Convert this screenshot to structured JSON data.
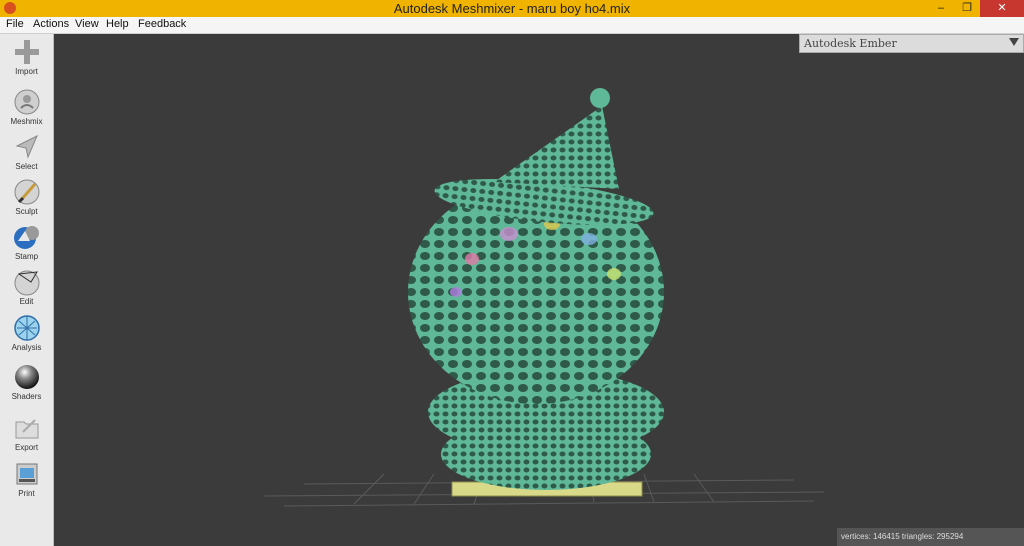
{
  "window": {
    "title": "Autodesk Meshmixer - maru boy ho4.mix",
    "minimize": "–",
    "maximize": "❐",
    "close": "✕"
  },
  "menu": [
    "File",
    "Actions",
    "View",
    "Help",
    "Feedback"
  ],
  "tools": [
    {
      "label": "Import",
      "icon": "plus-icon"
    },
    {
      "label": "Meshmix",
      "icon": "meshmix-icon"
    },
    {
      "label": "Select",
      "icon": "select-arrow-icon"
    },
    {
      "label": "Sculpt",
      "icon": "sculpt-brush-icon"
    },
    {
      "label": "Stamp",
      "icon": "stamp-icon"
    },
    {
      "label": "Edit",
      "icon": "edit-icon"
    },
    {
      "label": "Analysis",
      "icon": "analysis-icon"
    },
    {
      "label": "Shaders",
      "icon": "shaders-icon"
    },
    {
      "label": "Export",
      "icon": "export-folder-icon"
    },
    {
      "label": "Print",
      "icon": "print-icon"
    }
  ],
  "printer": {
    "selected": "Autodesk Ember"
  },
  "status": {
    "text": "vertices: 146415 triangles: 295294"
  },
  "colors": {
    "titlebar": "#f0b400",
    "mesh": "#5fb897",
    "viewport": "#3b3b3b"
  }
}
